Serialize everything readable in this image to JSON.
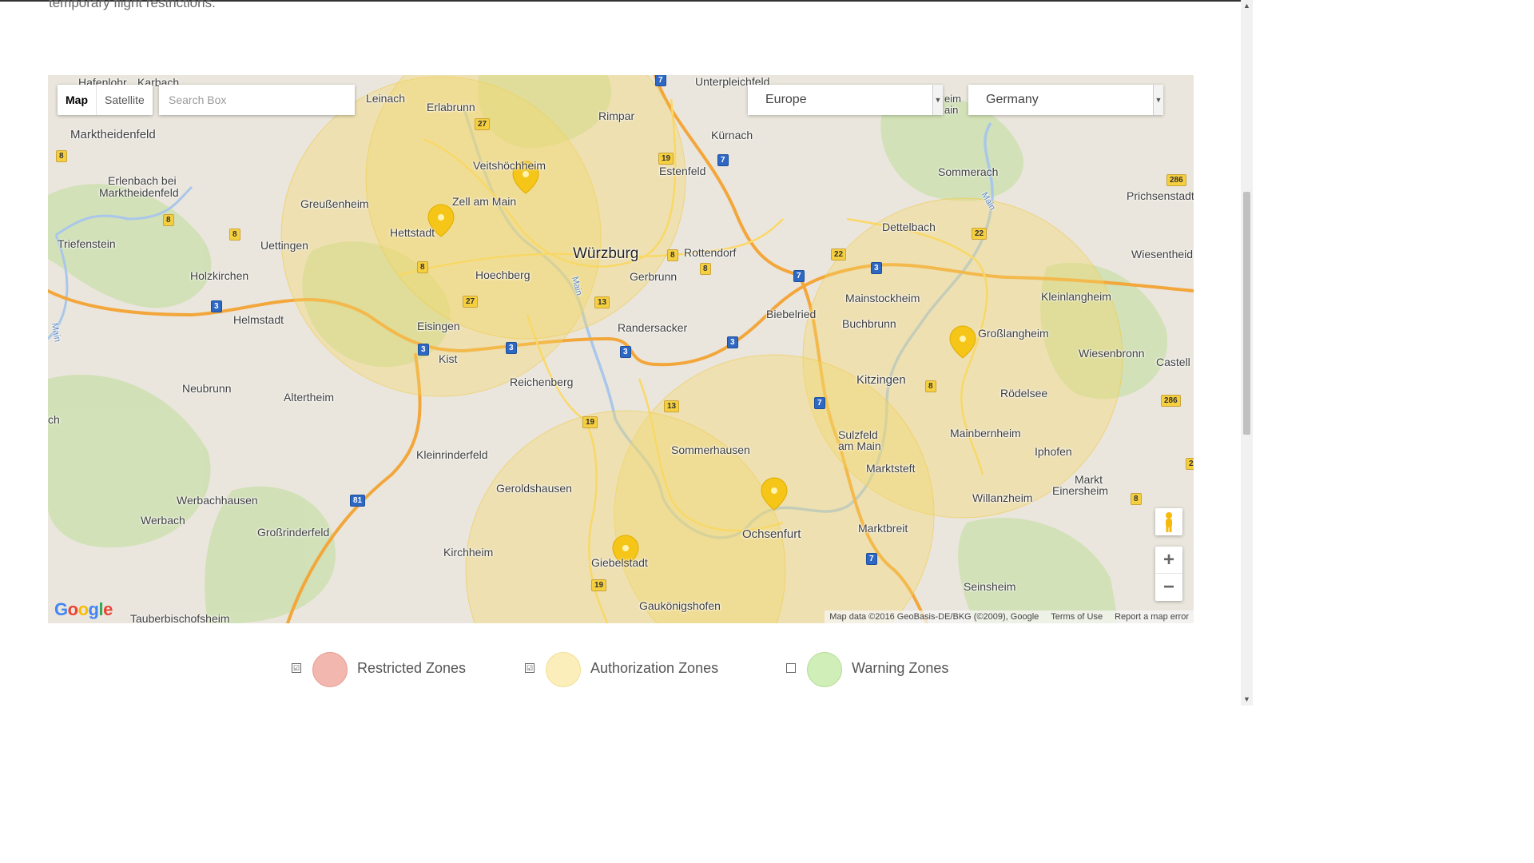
{
  "intro": {
    "text": "temporary flight restrictions."
  },
  "map": {
    "type_control": {
      "map_label": "Map",
      "satellite_label": "Satellite",
      "active": "Map"
    },
    "search": {
      "placeholder": "Search Box"
    },
    "region_select": {
      "value": "Europe"
    },
    "country_select": {
      "value": "Germany"
    },
    "logo_text": "Google",
    "attribution": {
      "data": "Map data ©2016 GeoBasis-DE/BKG (©2009), Google",
      "terms": "Terms of Use",
      "report": "Report a map error"
    },
    "zoom": {
      "in_label": "+",
      "out_label": "−"
    },
    "place_labels": [
      "Hafenlohr",
      "Karbach",
      "Marktheidenfeld",
      "Erlenbach bei",
      "Marktheidenfeld",
      "Triefenstein",
      "Holzkirchen",
      "Helmstadt",
      "Uettingen",
      "Greußenheim",
      "Leinach",
      "Erlabrunn",
      "Veitshöchheim",
      "Zell am Main",
      "Hettstadt",
      "Hoechberg",
      "Eisingen",
      "Kist",
      "Würzburg",
      "Gerbrunn",
      "Randersacker",
      "Rimpar",
      "Estenfeld",
      "Unterpleichfeld",
      "Kürnach",
      "Rottendorf",
      "Biebelried",
      "Sommerach",
      "Dettelbach",
      "Prichsenstadt",
      "Wiesentheid",
      "Mainstockheim",
      "Buchbrunn",
      "Kleinlangheim",
      "Großlangheim",
      "Wiesenbronn",
      "Castell",
      "Kitzingen",
      "Rödelsee",
      "Mainbernheim",
      "Iphofen",
      "Sulzfeld",
      "am Main",
      "Marktsteft",
      "Markt",
      "Einersheim",
      "Willanzheim",
      "Marktbreit",
      "Seinsheim",
      "Reichenberg",
      "Neubrunn",
      "Altertheim",
      "Kleinrinderfeld",
      "Geroldshausen",
      "Sommerhausen",
      "Werbachhausen",
      "Werbach",
      "Großrinderfeld",
      "Kirchheim",
      "Giebelstadt",
      "Ochsenfurt",
      "Gaukönigshofen",
      "Tauberbischofsheim",
      "ch",
      "Main",
      "Main",
      "Main",
      "eim",
      "ain"
    ],
    "road_shields": {
      "yellow": [
        "8",
        "8",
        "8",
        "8",
        "27",
        "27",
        "19",
        "13",
        "8",
        "22",
        "22",
        "8",
        "8",
        "286",
        "286",
        "19",
        "19",
        "13",
        "8",
        "2"
      ],
      "blue": [
        "7",
        "7",
        "7",
        "7",
        "7",
        "3",
        "3",
        "3",
        "3",
        "3",
        "3",
        "81"
      ]
    },
    "marker_icon": "map-pin-icon",
    "zone_color": "#f5d86a"
  },
  "legend": {
    "items": [
      {
        "label": "Restricted Zones",
        "checked": true,
        "color": "#f2b8b0",
        "check_glyph": "☑"
      },
      {
        "label": "Authorization Zones",
        "checked": true,
        "color": "#fbeebb",
        "check_glyph": "☑"
      },
      {
        "label": "Warning Zones",
        "checked": false,
        "color": "#cfeeb8",
        "check_glyph": ""
      }
    ]
  },
  "scrollbar": {
    "up": "▲",
    "down": "▼"
  }
}
